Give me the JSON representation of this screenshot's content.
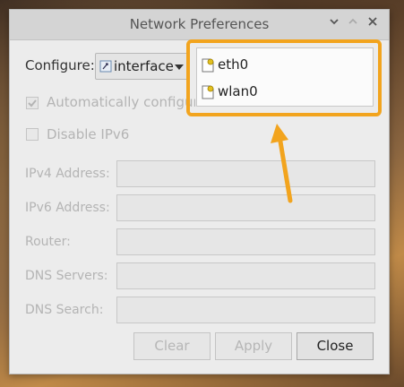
{
  "window": {
    "title": "Network Preferences",
    "controls": [
      "chevron-down-icon",
      "chevron-up-icon",
      "close-icon"
    ]
  },
  "configure": {
    "label": "Configure:",
    "selected": "interface"
  },
  "options": {
    "auto_configure": "Automatically configure empty options",
    "disable_ipv6": "Disable IPv6"
  },
  "fields": {
    "ipv4_label": "IPv4 Address:",
    "ipv6_label": "IPv6 Address:",
    "router_label": "Router:",
    "dns_servers_label": "DNS Servers:",
    "dns_search_label": "DNS Search:"
  },
  "buttons": {
    "clear": "Clear",
    "apply": "Apply",
    "close": "Close"
  },
  "dropdown": {
    "items": [
      "eth0",
      "wlan0"
    ]
  },
  "colors": {
    "highlight": "#f2a41e",
    "window_bg": "#ececec",
    "disabled_text": "#b4b4b4"
  }
}
